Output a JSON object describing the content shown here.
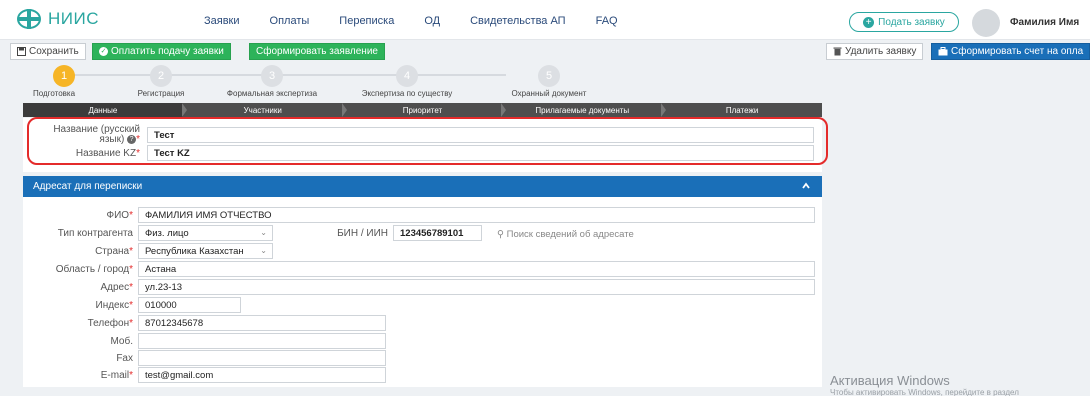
{
  "app": {
    "logo_text": "НИИС"
  },
  "nav": [
    "Заявки",
    "Оплаты",
    "Переписка",
    "ОД",
    "Свидетельства АП",
    "FAQ"
  ],
  "header": {
    "apply_button": "Подать заявку",
    "user_name": "Фамилия Имя"
  },
  "toolbar": {
    "save": "Сохранить",
    "pay": "Оплатить подачу заявки",
    "form_statement": "Сформировать заявление",
    "delete": "Удалить заявку",
    "form_invoice": "Сформировать счет на опла"
  },
  "steps": [
    {
      "number": "1",
      "label": "Подготовка"
    },
    {
      "number": "2",
      "label": "Регистрация"
    },
    {
      "number": "3",
      "label": "Формальная экспертиза"
    },
    {
      "number": "4",
      "label": "Экспертиза по существу"
    },
    {
      "number": "5",
      "label": "Охранный документ"
    }
  ],
  "tabs": [
    "Данные",
    "Участники",
    "Приоритет",
    "Прилагаемые документы",
    "Платежи"
  ],
  "names": {
    "ru_label_1": "Название (русский",
    "ru_label_2": "язык)",
    "ru_value": "Тест",
    "kz_label": "Название KZ",
    "kz_value": "Тест KZ"
  },
  "address": {
    "title": "Адресат для переписки",
    "fio_label": "ФИО",
    "fio_value": "ФАМИЛИЯ ИМЯ ОТЧЕСТВО",
    "type_label": "Тип контрагента",
    "type_value": "Физ. лицо",
    "bin_label": "БИН / ИИН",
    "bin_value": "123456789101",
    "search_text": "Поиск сведений об адресате",
    "country_label": "Страна",
    "country_value": "Республика Казахстан",
    "region_label": "Область / город",
    "region_value": "Астана",
    "addr_label": "Адрес",
    "addr_value": "ул.23-13",
    "index_label": "Индекс",
    "index_value": "010000",
    "phone_label": "Телефон",
    "phone_value": "87012345678",
    "mob_label": "Моб.",
    "mob_value": "",
    "fax_label": "Fax",
    "fax_value": "",
    "email_label": "E-mail",
    "email_value": "test@gmail.com"
  },
  "watermark": {
    "line1": "Активация Windows",
    "line2": "Чтобы активировать Windows, перейдите в раздел"
  }
}
